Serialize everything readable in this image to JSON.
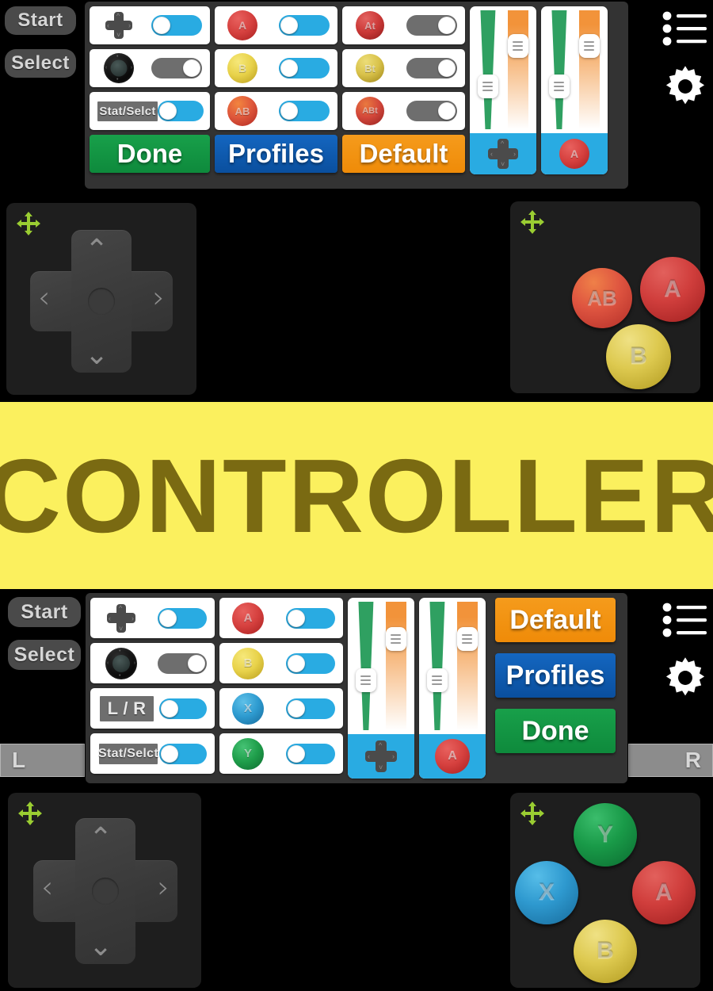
{
  "banner": {
    "title": "CONTROLLER",
    "bg": "#fbf05e",
    "text_color": "#7a6a12"
  },
  "colors": {
    "toggle_on": "#29abe2",
    "toggle_off": "#6e6e6e",
    "panel_bg": "#333333",
    "done": "#18a04a",
    "profiles": "#1466c0",
    "default": "#f59b1c",
    "slider_size": "#2fa061",
    "slider_opacity": "#f2933a",
    "move_handle": "#9acd32",
    "btn_a": "#d6413f",
    "btn_b": "#e8d24a",
    "btn_x": "#2e9bd0",
    "btn_y": "#1f9e4b",
    "btn_ab": "#e0593c"
  },
  "top_overlay": {
    "side_labels": [
      {
        "name": "start",
        "label": "Start"
      },
      {
        "name": "select",
        "label": "Select"
      }
    ],
    "icons": [
      {
        "name": "list-menu-icon",
        "label": "list-menu-icon"
      },
      {
        "name": "gear-icon",
        "label": "gear-icon"
      }
    ],
    "panel": {
      "column_1": [
        {
          "glyph": "dpad",
          "glyph_label": "",
          "toggle": "on"
        },
        {
          "glyph": "stick",
          "glyph_label": "",
          "toggle": "off"
        },
        {
          "glyph": "tag",
          "glyph_label": "Stat/Selct",
          "toggle": "on"
        }
      ],
      "column_2": [
        {
          "glyph": "round",
          "glyph_label": "A",
          "color": "#d6413f",
          "toggle": "on"
        },
        {
          "glyph": "round",
          "glyph_label": "B",
          "color": "#e8d24a",
          "toggle": "on"
        },
        {
          "glyph": "round",
          "glyph_label": "AB",
          "color": "#e0593c",
          "toggle": "on"
        }
      ],
      "column_3": [
        {
          "glyph": "round",
          "glyph_label": "At",
          "color": "#cc3937",
          "toggle": "off"
        },
        {
          "glyph": "round",
          "glyph_label": "Bt",
          "color": "#d9c24a",
          "toggle": "off"
        },
        {
          "glyph": "round",
          "glyph_label": "ABt",
          "color": "#d3473a",
          "toggle": "off"
        }
      ],
      "buttons": [
        {
          "name": "done",
          "label": "Done",
          "style": "green"
        },
        {
          "name": "profiles",
          "label": "Profiles",
          "style": "blue"
        },
        {
          "name": "default",
          "label": "Default",
          "style": "orange"
        }
      ],
      "sliders": [
        {
          "name": "dpad-slider",
          "foot_glyph": "dpad",
          "foot_label": "",
          "size_pct": 62,
          "opacity_pct": 72
        },
        {
          "name": "a-button-slider",
          "foot_glyph": "round",
          "foot_label": "A",
          "size_pct": 62,
          "opacity_pct": 72
        }
      ]
    },
    "dpad_widget": {
      "name": "dpad",
      "handle": "move-handle-icon"
    },
    "buttons_widget": {
      "name": "action-buttons",
      "handle": "move-handle-icon",
      "buttons": [
        {
          "label": "AB",
          "color": "#e0593c"
        },
        {
          "label": "A",
          "color": "#d6413f"
        },
        {
          "label": "B",
          "color": "#e8d24a"
        }
      ]
    }
  },
  "bottom_overlay": {
    "side_labels": [
      {
        "name": "start",
        "label": "Start"
      },
      {
        "name": "select",
        "label": "Select"
      }
    ],
    "shoulders": [
      {
        "name": "l-shoulder",
        "label": "L"
      },
      {
        "name": "r-shoulder",
        "label": "R"
      }
    ],
    "icons": [
      {
        "name": "list-menu-icon",
        "label": "list-menu-icon"
      },
      {
        "name": "gear-icon",
        "label": "gear-icon"
      }
    ],
    "panel": {
      "column_1": [
        {
          "glyph": "dpad",
          "glyph_label": "",
          "toggle": "on"
        },
        {
          "glyph": "stick",
          "glyph_label": "",
          "toggle": "off"
        },
        {
          "glyph": "tag",
          "glyph_label": "L / R",
          "toggle": "on"
        },
        {
          "glyph": "tag",
          "glyph_label": "Stat/Selct",
          "toggle": "on"
        }
      ],
      "column_2": [
        {
          "glyph": "round",
          "glyph_label": "A",
          "color": "#d6413f",
          "toggle": "on"
        },
        {
          "glyph": "round",
          "glyph_label": "B",
          "color": "#e8d24a",
          "toggle": "on"
        },
        {
          "glyph": "round",
          "glyph_label": "X",
          "color": "#2e9bd0",
          "toggle": "on"
        },
        {
          "glyph": "round",
          "glyph_label": "Y",
          "color": "#1f9e4b",
          "toggle": "on"
        }
      ],
      "buttons": [
        {
          "name": "default",
          "label": "Default",
          "style": "orange"
        },
        {
          "name": "profiles",
          "label": "Profiles",
          "style": "blue"
        },
        {
          "name": "done",
          "label": "Done",
          "style": "green"
        }
      ],
      "sliders": [
        {
          "name": "dpad-slider",
          "foot_glyph": "dpad",
          "foot_label": "",
          "size_pct": 62,
          "opacity_pct": 72
        },
        {
          "name": "a-button-slider",
          "foot_glyph": "round",
          "foot_label": "A",
          "size_pct": 62,
          "opacity_pct": 72
        }
      ]
    },
    "dpad_widget": {
      "name": "dpad",
      "handle": "move-handle-icon"
    },
    "buttons_widget": {
      "name": "action-buttons",
      "handle": "move-handle-icon",
      "buttons": [
        {
          "label": "Y",
          "color": "#1f9e4b"
        },
        {
          "label": "X",
          "color": "#2e9bd0"
        },
        {
          "label": "A",
          "color": "#d6413f"
        },
        {
          "label": "B",
          "color": "#e8d24a"
        }
      ]
    }
  }
}
